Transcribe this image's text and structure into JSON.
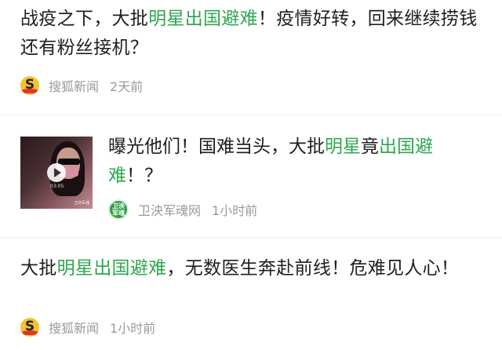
{
  "items": [
    {
      "title_parts": [
        {
          "text": "战疫之下，大批",
          "hl": false
        },
        {
          "text": "明星出国避难",
          "hl": true
        },
        {
          "text": "！疫情好转，回来继续捞钱还有粉丝接机？",
          "hl": false
        }
      ],
      "source": "搜狐新闻",
      "time": "2天前",
      "logo_letter": "S"
    },
    {
      "title_parts": [
        {
          "text": "曝光他们！国难当头，大批",
          "hl": false
        },
        {
          "text": "明星",
          "hl": true
        },
        {
          "text": "竟",
          "hl": false
        },
        {
          "text": "出国避难",
          "hl": true
        },
        {
          "text": "！？",
          "hl": false
        }
      ],
      "source": "卫泱军魂网",
      "time": "1小时前",
      "logo_lines": [
        "卫泱",
        "军魂"
      ],
      "thumb_time": "03:05",
      "thumb_watermark": "卫泱军魂"
    },
    {
      "title_parts": [
        {
          "text": "大批",
          "hl": false
        },
        {
          "text": "明星出国避难",
          "hl": true
        },
        {
          "text": "，无数医生奔赴前线！危难见人心！",
          "hl": false
        }
      ],
      "source": "搜狐新闻",
      "time": "1小时前",
      "logo_letter": "S"
    }
  ],
  "colors": {
    "highlight": "#2fa650",
    "meta_text": "#9a9a9a",
    "divider": "#ededed"
  },
  "icons": [
    "play-icon",
    "sohu-logo-icon",
    "weiyang-logo-icon"
  ]
}
